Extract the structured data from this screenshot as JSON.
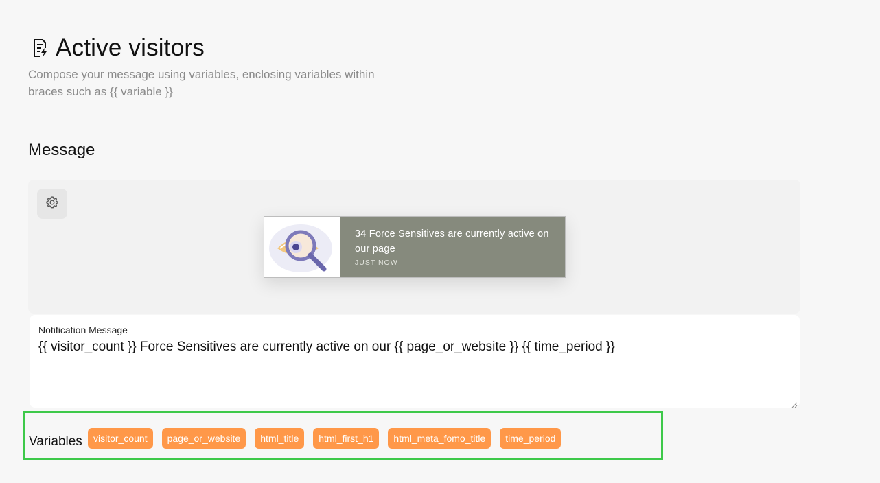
{
  "header": {
    "title": "Active visitors",
    "title_icon": "document-edit-icon",
    "subtitle": "Compose your message using variables, enclosing variables within braces such as {{ variable }}"
  },
  "message_section": {
    "title": "Message",
    "settings_icon": "gear-icon",
    "preview": {
      "message": "34 Force Sensitives are currently active on our page",
      "time": "JUST NOW",
      "image_icon": "eye-magnifier-icon"
    },
    "input": {
      "label": "Notification Message",
      "value": "{{ visitor_count }} Force Sensitives are currently active on our {{ page_or_website }} {{ time_period }}"
    }
  },
  "variables": {
    "label": "Variables",
    "items": [
      "visitor_count",
      "page_or_website",
      "html_title",
      "html_first_h1",
      "html_meta_fomo_title",
      "time_period"
    ]
  },
  "colors": {
    "page_background": "#f7f7f7",
    "chip": "#ff9849",
    "preview_card": "#868a7d",
    "highlight_border": "#3ec94a"
  }
}
